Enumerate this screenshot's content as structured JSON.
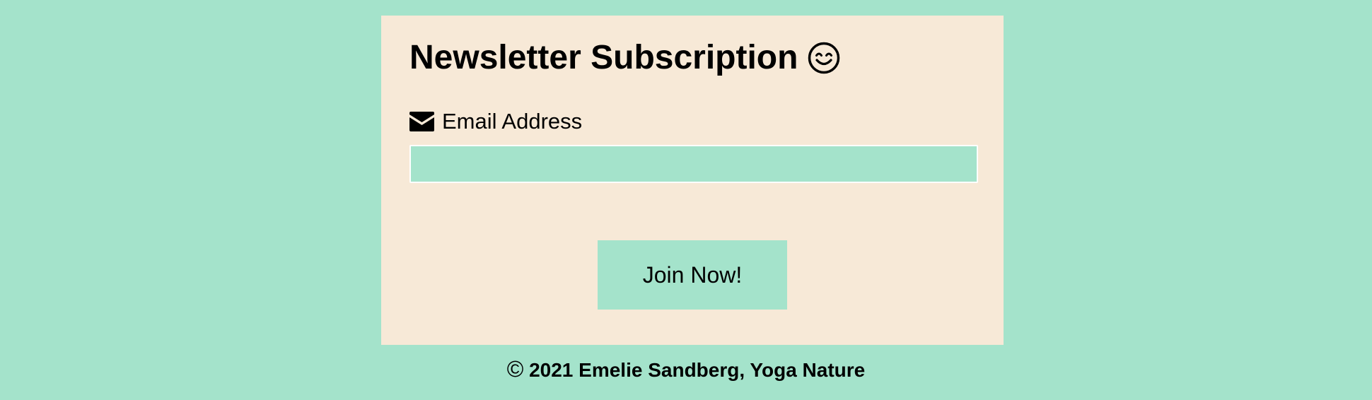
{
  "newsletter": {
    "title": "Newsletter Subscription",
    "title_icon": "smiling-face-icon",
    "email_label": "Email Address",
    "email_icon": "envelope-icon",
    "email_value": "",
    "email_placeholder": "",
    "submit_label": "Join Now!"
  },
  "footer": {
    "copyright_symbol": "©",
    "text": "2021 Emelie Sandberg, Yoga Nature"
  },
  "colors": {
    "page_background": "#a4e3cb",
    "card_background": "#f7e9d7",
    "input_background": "#a4e3cb",
    "button_background": "#a4e3cb"
  }
}
